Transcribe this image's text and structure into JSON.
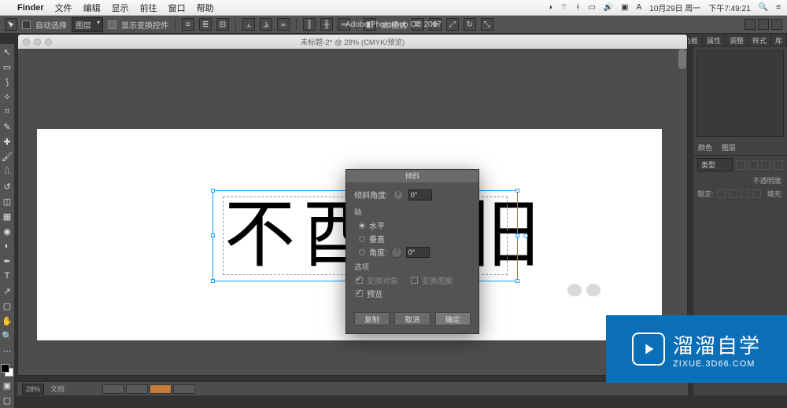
{
  "menubar": {
    "app": "Finder",
    "items": [
      "文件",
      "编辑",
      "显示",
      "前往",
      "窗口",
      "帮助"
    ],
    "date": "10月29日 周一",
    "time": "下午7:49:21",
    "apple": ""
  },
  "options": {
    "auto_select": "自动选择",
    "layer": "图层",
    "show_transform": "显示变换控件",
    "mode3d": "3D模式",
    "apptitle": "Adobe Photoshop CC 2017"
  },
  "rtabs": [
    "色板",
    "属性",
    "调整",
    "样式",
    "库"
  ],
  "doc": {
    "title": "未标题-2* @ 28% (CMYK/预览)"
  },
  "kanji": {
    "c1": "不",
    "c2": "酉",
    "c3": "旧"
  },
  "dialog": {
    "title": "倾斜",
    "angle_label": "倾斜角度:",
    "angle_value": "0°",
    "axis_label": "轴",
    "axis_h": "水平",
    "axis_v": "垂直",
    "axis_angle": "角度:",
    "axis_angle_value": "0°",
    "options_label": "选项",
    "transform_obj": "变换对象",
    "transform_pat": "变换图案",
    "preview": "预览",
    "btn_copy": "复制",
    "btn_cancel": "取消",
    "btn_ok": "确定"
  },
  "layers": {
    "tabs": [
      "颜色",
      "图层"
    ],
    "kind": "类型",
    "opacity": "不透明度:",
    "fill": "填充:",
    "lock": "锁定:"
  },
  "status": {
    "zoom": "28%",
    "info": "文档"
  },
  "wm": {
    "cn": "溜溜自学",
    "en": "ZIXUE.3D66.COM"
  }
}
